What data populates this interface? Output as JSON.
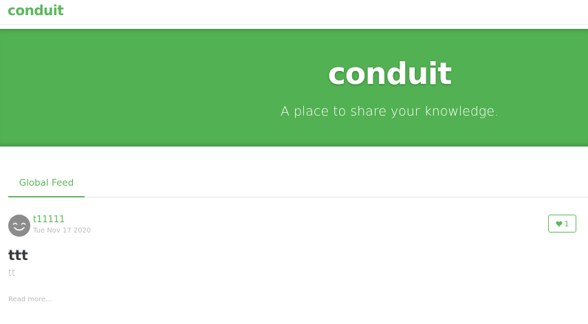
{
  "navbar": {
    "brand": "conduit"
  },
  "banner": {
    "title": "conduit",
    "subtitle": "A place to share your knowledge."
  },
  "feed": {
    "tabs": [
      {
        "label": "Global Feed",
        "active": true
      }
    ]
  },
  "articles": [
    {
      "author": "t11111",
      "date": "Tue Nov 17 2020",
      "favorites_count": "1",
      "title": "ttt",
      "description": "tt",
      "read_more": "Read more..."
    }
  ],
  "colors": {
    "accent": "#5cb85c",
    "banner": "#52b152",
    "text_dark": "#373a3c",
    "text_muted": "#bbbbbb",
    "avatar": "#8c8c8c"
  },
  "icons": {
    "avatar": "smiley-face-icon",
    "favorite": "heart-icon"
  }
}
